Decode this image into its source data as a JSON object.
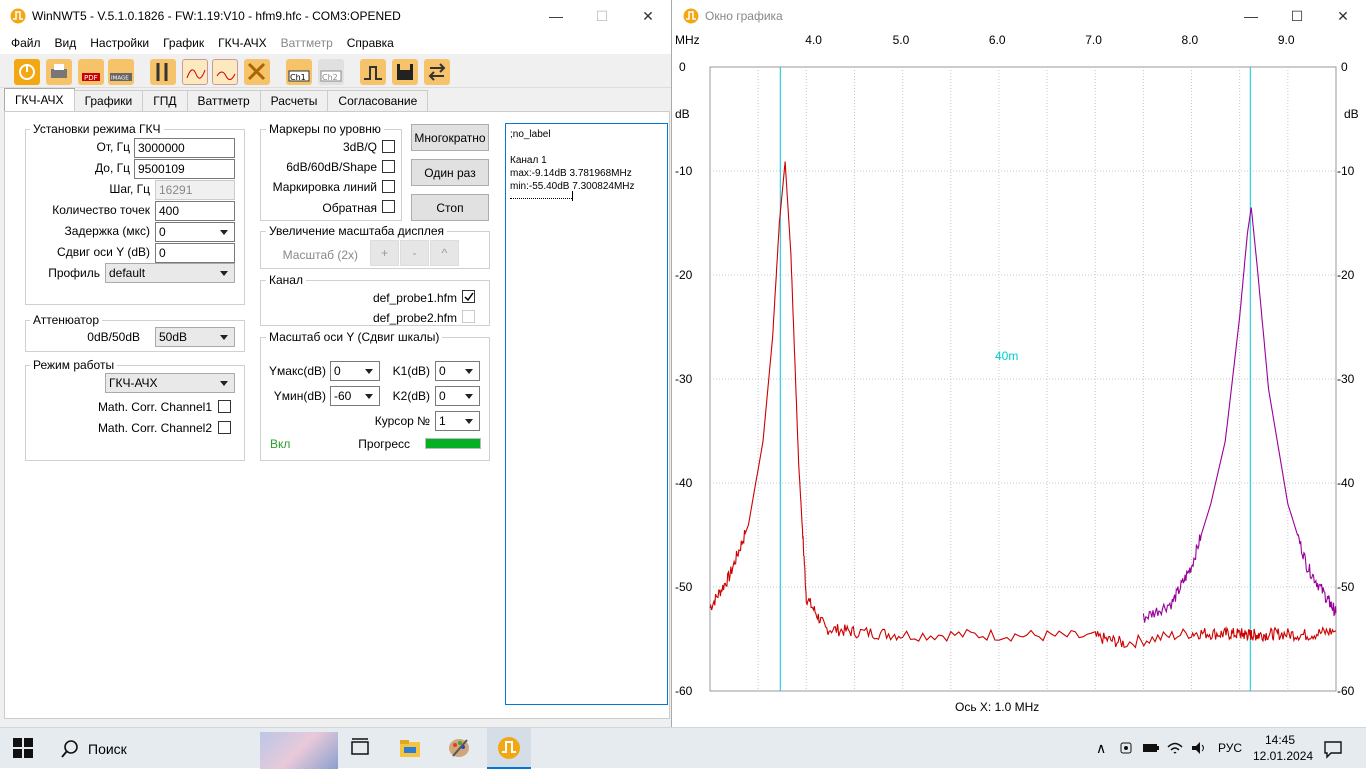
{
  "main": {
    "title": "WinNWT5 - V.5.1.0.1826 - FW:1.19:V10 - hfm9.hfc - COM3:OPENED",
    "menu": [
      "Файл",
      "Вид",
      "Настройки",
      "График",
      "ГКЧ-АЧХ",
      "Ваттметр",
      "Справка"
    ],
    "tabs": [
      "ГКЧ-АЧХ",
      "Графики",
      "ГПД",
      "Ваттметр",
      "Расчеты",
      "Согласование"
    ],
    "gen": {
      "title": "Установки режима ГКЧ",
      "from_label": "От, Гц",
      "from_value": "3000000",
      "to_label": "До, Гц",
      "to_value": "9500109",
      "step_label": "Шаг, Гц",
      "step_value": "16291",
      "points_label": "Количество точек",
      "points_value": "400",
      "delay_label": "Задержка (мкс)",
      "delay_value": "0",
      "yshift_label": "Сдвиг оси Y (dB)",
      "yshift_value": "0",
      "profile_label": "Профиль",
      "profile_value": "default"
    },
    "att": {
      "title": "Аттенюатор",
      "label": "0dB/50dB",
      "value": "50dB"
    },
    "mode": {
      "title": "Режим работы",
      "value": "ГКЧ-АЧХ",
      "corr1": "Math. Corr. Channel1",
      "corr2": "Math. Corr. Channel2"
    },
    "markers": {
      "title": "Маркеры по уровню",
      "m1": "3dB/Q",
      "m2": "6dB/60dB/Shape",
      "m3": "Маркировка линий",
      "m4": "Обратная"
    },
    "buttons": {
      "multi": "Многократно",
      "once": "Один раз",
      "stop": "Стоп"
    },
    "zoom": {
      "title": "Увеличение масштаба дисплея",
      "label": "Масштаб (2x)",
      "plus": "+",
      "minus": "-",
      "up": "^"
    },
    "channel": {
      "title": "Канал",
      "ch1": "def_probe1.hfm",
      "ch2": "def_probe2.hfm"
    },
    "yscale": {
      "title": "Масштаб оси Y (Сдвиг шкалы)",
      "ymax_label": "Yмакс(dB)",
      "ymax_value": "0",
      "ymin_label": "Yмин(dB)",
      "ymin_value": "-60",
      "k1_label": "K1(dB)",
      "k1_value": "0",
      "k2_label": "K2(dB)",
      "k2_value": "0",
      "cursor_label": "Курсор №",
      "cursor_value": "1",
      "on_label": "Вкл",
      "progress_label": "Прогресс",
      "progress": 1.0
    },
    "log": {
      "line1": ";no_label",
      "line2": "Канал 1",
      "line3": "max:-9.14dB 3.781968MHz",
      "line4": "min:-55.40dB 7.300824MHz"
    }
  },
  "graph_window": {
    "title": "Окно графика",
    "x_unit": "MHz",
    "y_unit": "dB",
    "x_axis_caption": "Ось X: 1.0 MHz",
    "band_label": "40m"
  },
  "chart_data": {
    "type": "line",
    "xlim": [
      3.0,
      9.5
    ],
    "ylim": [
      -60,
      0
    ],
    "x_ticks": [
      "4.0",
      "5.0",
      "6.0",
      "7.0",
      "8.0",
      "9.0"
    ],
    "y_ticks": [
      "0",
      "-10",
      "-20",
      "-30",
      "-40",
      "-50",
      "-60"
    ],
    "cursors_x": [
      3.73,
      8.61
    ],
    "series": [
      {
        "color": "#cc0000",
        "x": [
          3.0,
          3.2,
          3.4,
          3.55,
          3.65,
          3.72,
          3.78,
          3.84,
          3.92,
          4.0,
          4.2,
          4.5,
          5.0,
          6.0,
          7.0,
          7.3,
          8.0,
          8.3,
          8.5,
          8.6,
          8.7,
          8.9,
          9.2,
          9.5
        ],
        "values": [
          -52,
          -49,
          -44,
          -36,
          -26,
          -15,
          -9.1,
          -18,
          -38,
          -51,
          -54,
          -54.3,
          -54.6,
          -54.6,
          -54.8,
          -55.4,
          -54.4,
          -54.5,
          -54.5,
          -54.6,
          -54.6,
          -54.5,
          -54.6,
          -54.2
        ]
      },
      {
        "color": "#990099",
        "x": [
          7.5,
          7.8,
          8.0,
          8.2,
          8.35,
          8.5,
          8.58,
          8.62,
          8.68,
          8.8,
          9.0,
          9.2,
          9.4,
          9.5
        ],
        "values": [
          -53,
          -51.5,
          -48,
          -42,
          -36,
          -24,
          -16,
          -13.5,
          -19,
          -31,
          -42,
          -48,
          -51,
          -52.5
        ]
      }
    ]
  },
  "taskbar": {
    "search": "Поиск",
    "lang": "РУС",
    "time": "14:45",
    "date": "12.01.2024"
  }
}
